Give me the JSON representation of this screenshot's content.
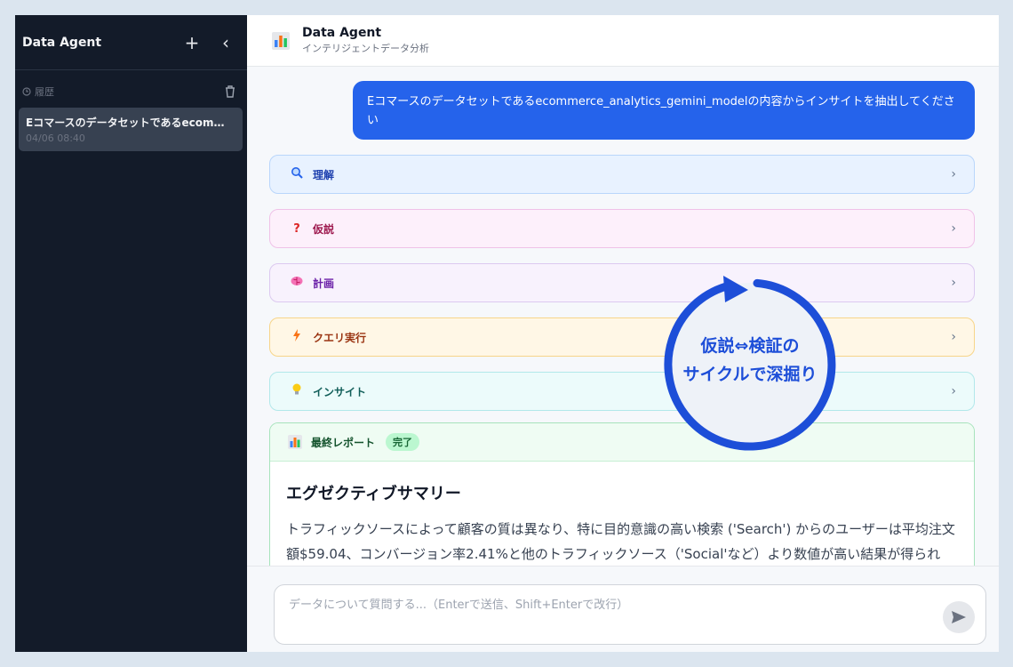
{
  "sidebar": {
    "title": "Data Agent",
    "new_chat_label": "+",
    "collapse_label": "‹",
    "history_label": "履歴",
    "items": [
      {
        "title": "Eコマースのデータセットであるecom…",
        "date": "04/06 08:40"
      }
    ]
  },
  "header": {
    "title": "Data Agent",
    "subtitle": "インテリジェントデータ分析"
  },
  "chat": {
    "user_message": "Eコマースのデータセットであるecommerce_analytics_gemini_modelの内容からインサイトを抽出してください",
    "steps": [
      {
        "label": "理解",
        "icon": "magnifier-icon"
      },
      {
        "label": "仮説",
        "icon": "question-icon"
      },
      {
        "label": "計画",
        "icon": "brain-icon"
      },
      {
        "label": "クエリ実行",
        "icon": "lightning-icon"
      },
      {
        "label": "インサイト",
        "icon": "lightbulb-icon"
      }
    ],
    "report": {
      "label": "最終レポート",
      "status": "完了",
      "heading": "エグゼクティブサマリー",
      "body": "トラフィックソースによって顧客の質は異なり、特に目的意識の高い検索 ('Search') からのユーザーは平均注文額$59.04、コンバージョン率2.41%と他のトラフィックソース（'Social'など）より数値が高い結果が得られた。追加検討が必要な点として、どのようなキーワードでの検索が多いのかを深掘"
    }
  },
  "overlay": {
    "line1": "仮説⇔検証の",
    "line2": "サイクルで深掘り",
    "color": "#1d4ed8"
  },
  "input": {
    "placeholder": "データについて質問する...（Enterで送信、Shift+Enterで改行）"
  }
}
